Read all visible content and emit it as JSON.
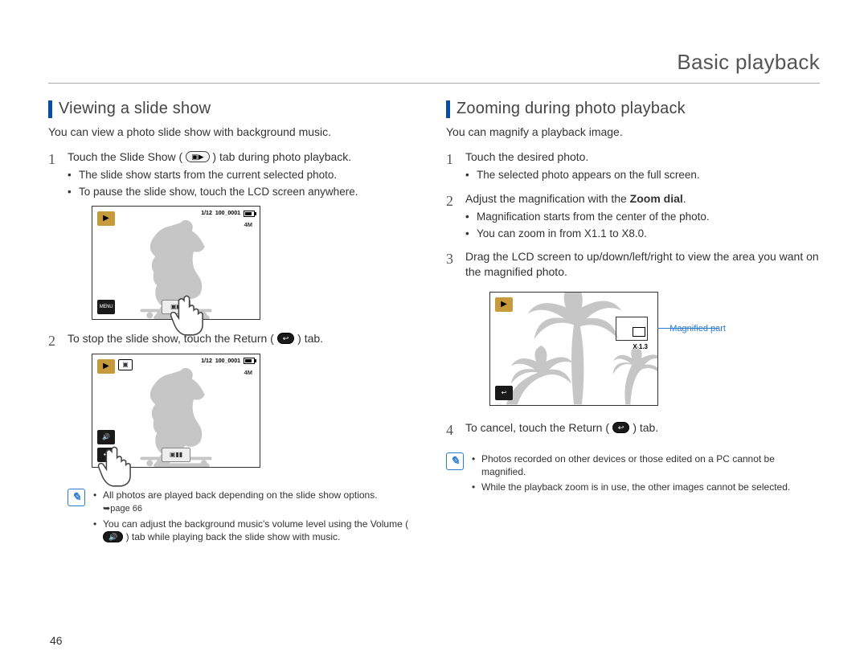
{
  "pageTitle": "Basic playback",
  "pageNumber": "46",
  "left": {
    "heading": "Viewing a slide show",
    "intro": "You can view a photo slide show with background music.",
    "step1": "Touch the Slide Show (",
    "step1_tail": ") tab during photo playback.",
    "step1_sub1": "The slide show starts from the current selected photo.",
    "step1_sub2": "To pause the slide show, touch the LCD screen anywhere.",
    "step2": "To stop the slide show, touch the Return (",
    "step2_tail": ") tab.",
    "note1": "All photos are played back depending on the slide show options.",
    "note1_ref": "➥page 66",
    "note2a": "You can adjust the background music's volume level using the Volume (",
    "note2b": ") tab while playing back the slide show with music.",
    "lcd": {
      "frac": "1/12",
      "file": "100_0001",
      "res": "4M",
      "menu": "MENU"
    }
  },
  "right": {
    "heading": "Zooming during photo playback",
    "intro": "You can magnify a playback image.",
    "step1": "Touch the desired photo.",
    "step1_sub1": "The selected photo appears on the full screen.",
    "step2a": "Adjust the magnification with the ",
    "step2b_bold": "Zoom dial",
    "step2c": ".",
    "step2_sub1": "Magnification starts from the center of the photo.",
    "step2_sub2": "You can zoom in from X1.1 to X8.0.",
    "step3": "Drag the LCD screen to up/down/left/right to view the area you want on the magnified photo.",
    "step4": "To cancel, touch the Return (",
    "step4_tail": ") tab.",
    "zoom_label": "Magnified part",
    "zoom_ratio": "X 1.3",
    "note1": "Photos recorded on other devices or those edited on a PC cannot be magnified.",
    "note2": "While the playback zoom is in use, the other images cannot be selected."
  }
}
